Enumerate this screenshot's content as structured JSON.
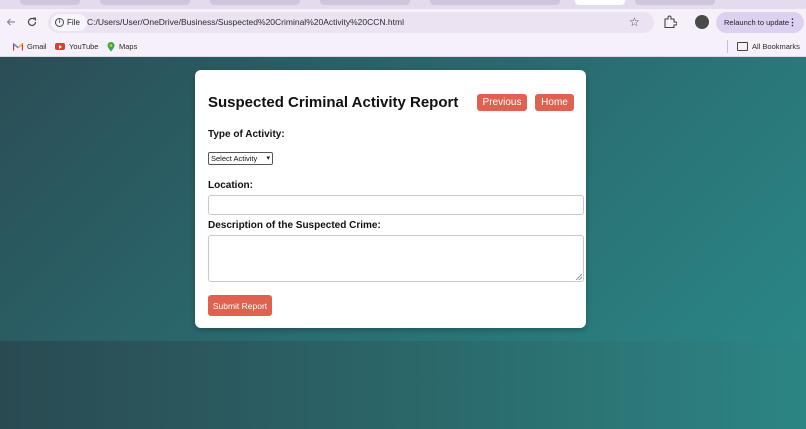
{
  "browser": {
    "url": "C:/Users/User/OneDrive/Business/Suspected%20Criminal%20Activity%20CCN.html",
    "site_chip_label": "File",
    "relaunch_label": "Relaunch to update",
    "bookmarks": [
      {
        "label": "Gmail",
        "icon": "gmail-icon"
      },
      {
        "label": "YouTube",
        "icon": "youtube-icon"
      },
      {
        "label": "Maps",
        "icon": "maps-icon"
      }
    ],
    "all_bookmarks_label": "All Bookmarks"
  },
  "form": {
    "title": "Suspected Criminal Activity Report",
    "previous_label": "Previous",
    "home_label": "Home",
    "type_label": "Type of Activity:",
    "type_selected": "Select Activity",
    "location_label": "Location:",
    "location_value": "",
    "description_label": "Description of the Suspected Crime:",
    "description_value": "",
    "submit_label": "Submit Report"
  },
  "colors": {
    "accent": "#e0614f",
    "page_bg_start": "#2b4d56",
    "page_bg_end": "#2a8a88",
    "chrome_bg": "#f6f0fb"
  }
}
